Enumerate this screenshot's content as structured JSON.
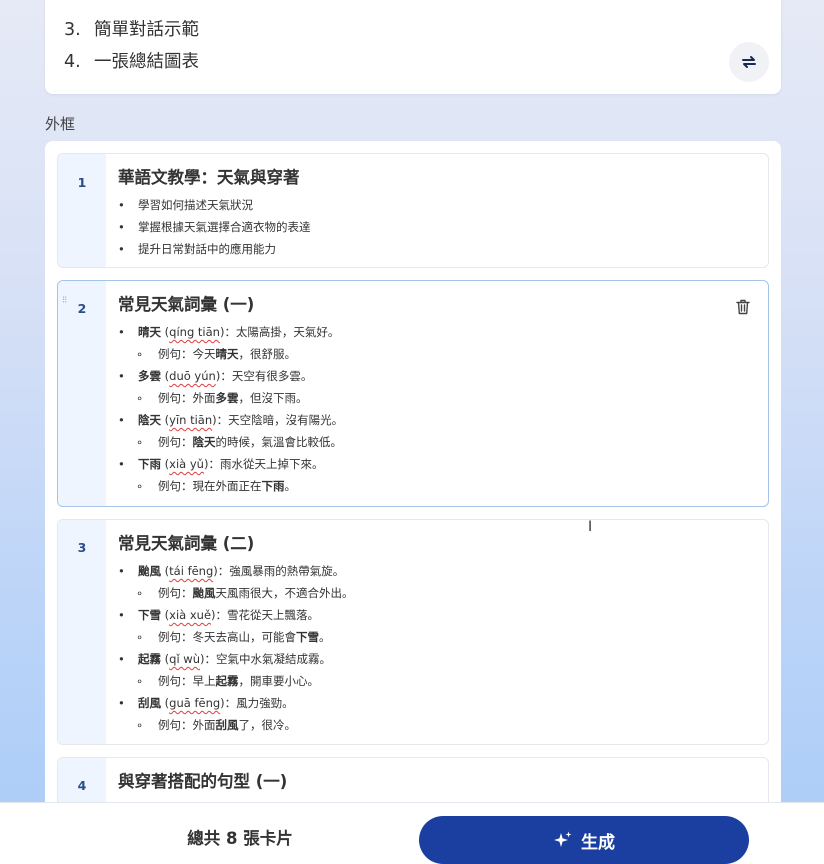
{
  "outline_tail": [
    {
      "num": "3.",
      "text": "簡單對話示範"
    },
    {
      "num": "4.",
      "text": "一張總結圖表"
    }
  ],
  "section_label": "外框",
  "cards": [
    {
      "num": "1",
      "title": "華語文教學：天氣與穿著",
      "bullets": [
        "學習如何描述天氣狀況",
        "掌握根據天氣選擇合適衣物的表達",
        "提升日常對話中的應用能力"
      ]
    },
    {
      "num": "2",
      "title": "常見天氣詞彙 (一)",
      "items": [
        {
          "term": "晴天",
          "pinyin": "qíng tiān",
          "desc": "：太陽高掛，天氣好。",
          "example_prefix": "例句：今天",
          "example_bold": "晴天",
          "example_suffix": "，很舒服。"
        },
        {
          "term": "多雲",
          "pinyin": "duō yún",
          "desc": "：天空有很多雲。",
          "example_prefix": "例句：外面",
          "example_bold": "多雲",
          "example_suffix": "，但沒下雨。"
        },
        {
          "term": "陰天",
          "pinyin": "yīn tiān",
          "desc": "：天空陰暗，沒有陽光。",
          "example_prefix": "例句：",
          "example_bold": "陰天",
          "example_suffix": "的時候，氣溫會比較低。"
        },
        {
          "term": "下雨",
          "pinyin": "xià yǔ",
          "desc": "：雨水從天上掉下來。",
          "example_prefix": "例句：現在外面正在",
          "example_bold": "下雨",
          "example_suffix": "。"
        }
      ]
    },
    {
      "num": "3",
      "title": "常見天氣詞彙 (二)",
      "items": [
        {
          "term": "颱風",
          "pinyin": "tái fēng",
          "desc": "：強風暴雨的熱帶氣旋。",
          "example_prefix": "例句：",
          "example_bold": "颱風",
          "example_suffix": "天風雨很大，不適合外出。"
        },
        {
          "term": "下雪",
          "pinyin": "xià xuě",
          "desc": "：雪花從天上飄落。",
          "example_prefix": "例句：冬天去高山，可能會",
          "example_bold": "下雪",
          "example_suffix": "。"
        },
        {
          "term": "起霧",
          "pinyin": "qǐ wù",
          "desc": "：空氣中水氣凝結成霧。",
          "example_prefix": "例句：早上",
          "example_bold": "起霧",
          "example_suffix": "，開車要小心。"
        },
        {
          "term": "刮風",
          "pinyin": "guā fēng",
          "desc": "：風力強勁。",
          "example_prefix": "例句：外面",
          "example_bold": "刮風",
          "example_suffix": "了，很冷。"
        }
      ]
    },
    {
      "num": "4",
      "title": "與穿著搭配的句型 (一)"
    }
  ],
  "footer": {
    "count_label": "總共 8 張卡片",
    "generate_label": "生成"
  },
  "colors": {
    "accent": "#1a3fa0",
    "strip": "#eef5ff"
  }
}
